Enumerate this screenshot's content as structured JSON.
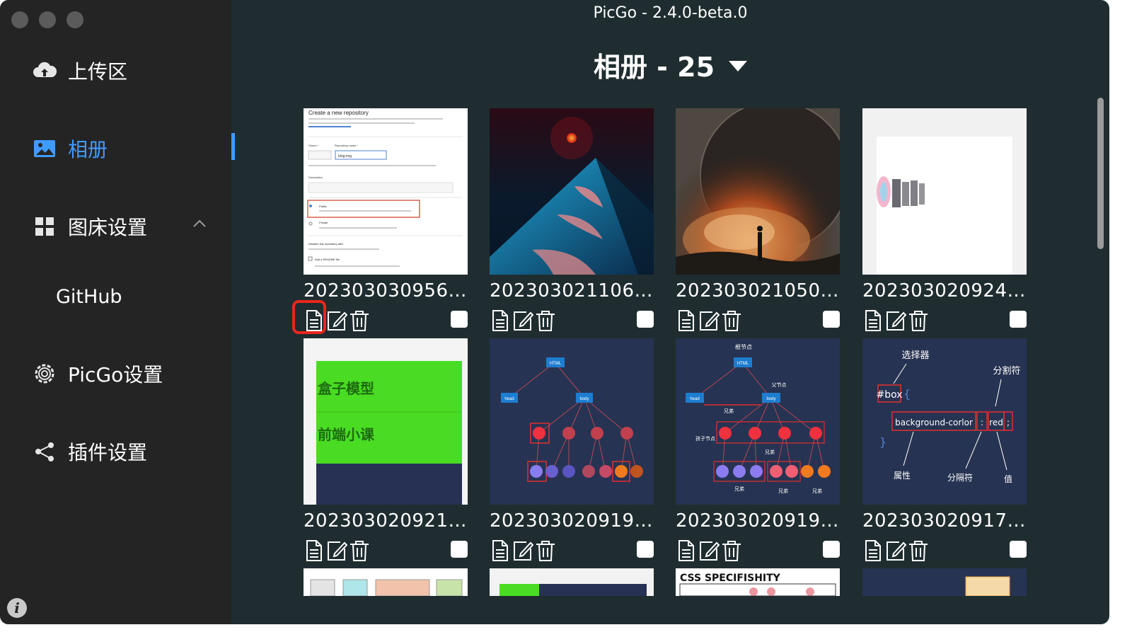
{
  "window": {
    "title": "PicGo - 2.4.0-beta.0"
  },
  "sidebar": {
    "items": [
      {
        "label": "上传区",
        "icon": "cloud-upload-icon"
      },
      {
        "label": "相册",
        "icon": "image-icon",
        "active": true
      },
      {
        "label": "图床设置",
        "icon": "grid-icon",
        "expanded": true
      },
      {
        "label": "PicGo设置",
        "icon": "gear-icon"
      },
      {
        "label": "插件设置",
        "icon": "share-icon"
      }
    ],
    "sub_items": [
      {
        "label": "GitHub"
      }
    ],
    "info_icon": "i"
  },
  "album": {
    "header": "相册 - 25",
    "cards": [
      {
        "name": "2023030309562...",
        "thumb": "github-new-repo-screenshot"
      },
      {
        "name": "2023030211061...",
        "thumb": "blue-dune-red-sun"
      },
      {
        "name": "2023030210502...",
        "thumb": "dark-planet-explosion"
      },
      {
        "name": "2023030209241...",
        "thumb": "blurred-logo-white"
      },
      {
        "name": "2023030209214...",
        "thumb": "green-box-model"
      },
      {
        "name": "2023030209195...",
        "thumb": "dom-tree-diagram"
      },
      {
        "name": "2023030209194...",
        "thumb": "dom-tree-labeled"
      },
      {
        "name": "2023030209174...",
        "thumb": "css-syntax-diagram"
      }
    ],
    "partial_row": [
      "color-boxes",
      "green-navy-bar",
      "css-specifishity",
      "navy-card"
    ],
    "partial_text": {
      "css_spec": "CSS SPECIFISHITY"
    },
    "actions": {
      "copy": "copy-link-icon",
      "edit": "edit-icon",
      "delete": "delete-icon"
    },
    "highlight_color": "#e8261d",
    "accent_color": "#3f9bff"
  },
  "thumb_text": {
    "repo_title": "Create a new repository",
    "repo_owner": "Owner *",
    "repo_name": "Repository name *",
    "repo_name_val": "blog-img",
    "repo_desc": "Description",
    "repo_public": "Public",
    "repo_private": "Private",
    "repo_init": "Initialize this repository with:",
    "repo_readme": "Add a README file",
    "box_model": "盒子模型",
    "front_course": "前端小课",
    "html": "HTML",
    "head": "head",
    "body": "body",
    "root_node": "根节点",
    "parent_node": "父节点",
    "child_nodes": "孩子节点",
    "siblings": "兄弟",
    "selector": "选择器",
    "separator": "分割符",
    "box_sel": "#box",
    "brace_open": "{",
    "brace_close": "}",
    "decl_prop": "background-corlor",
    "decl_colon": ":",
    "decl_val": "red",
    "decl_semi": ";",
    "attr": "属性",
    "sep2": "分隔符",
    "value": "值"
  }
}
